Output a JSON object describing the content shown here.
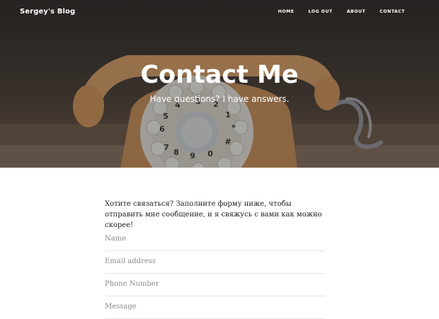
{
  "header": {
    "brand": "Sergey's Blog",
    "nav": [
      "HOME",
      "LOG OUT",
      "ABOUT",
      "CONTACT"
    ]
  },
  "hero": {
    "title": "Contact Me",
    "subtitle": "Have questions? I have answers."
  },
  "intro_text": "Хотите связаться? Заполните форму ниже, чтобы отправить мне сообщение, и я свяжусь с вами как можно скорее!",
  "form": {
    "name_placeholder": "Name",
    "email_placeholder": "Email address",
    "phone_placeholder": "Phone Number",
    "message_placeholder": "Message"
  },
  "colors": {
    "phone_body": "#c98a4a",
    "overlay": "#1e1c1c"
  }
}
